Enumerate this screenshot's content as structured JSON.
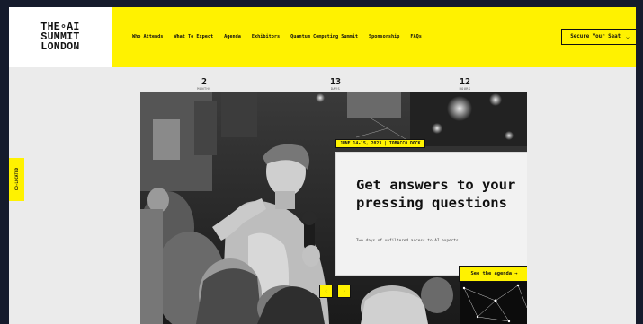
{
  "logo": {
    "lines": [
      "THE∘AI",
      "SUMMIT",
      "LONDON"
    ]
  },
  "nav": {
    "items": [
      "Who Attends",
      "What To Expect",
      "Agenda",
      "Exhibitors",
      "Quantum Computing Summit",
      "Sponsorship",
      "FAQs"
    ],
    "cta_label": "Secure Your Seat",
    "cta_icon": "chevron-icon"
  },
  "countdown": [
    {
      "value": "2",
      "unit": "MONTHS"
    },
    {
      "value": "13",
      "unit": "DAYS"
    },
    {
      "value": "12",
      "unit": "HOURS"
    }
  ],
  "side_tab": {
    "label": "CO-LOCATED"
  },
  "hero": {
    "date_tag": "JUNE 14-15, 2023 | TOBACCO DOCK",
    "headline": "Get answers to your pressing questions",
    "subtext": "Two days of unfiltered access to AI experts.",
    "agenda_label": "See the agenda →",
    "prev_icon": "‹",
    "next_icon": "›"
  },
  "colors": {
    "accent": "#fff200",
    "page_bg": "#151b2c",
    "surface": "#ebebeb"
  }
}
